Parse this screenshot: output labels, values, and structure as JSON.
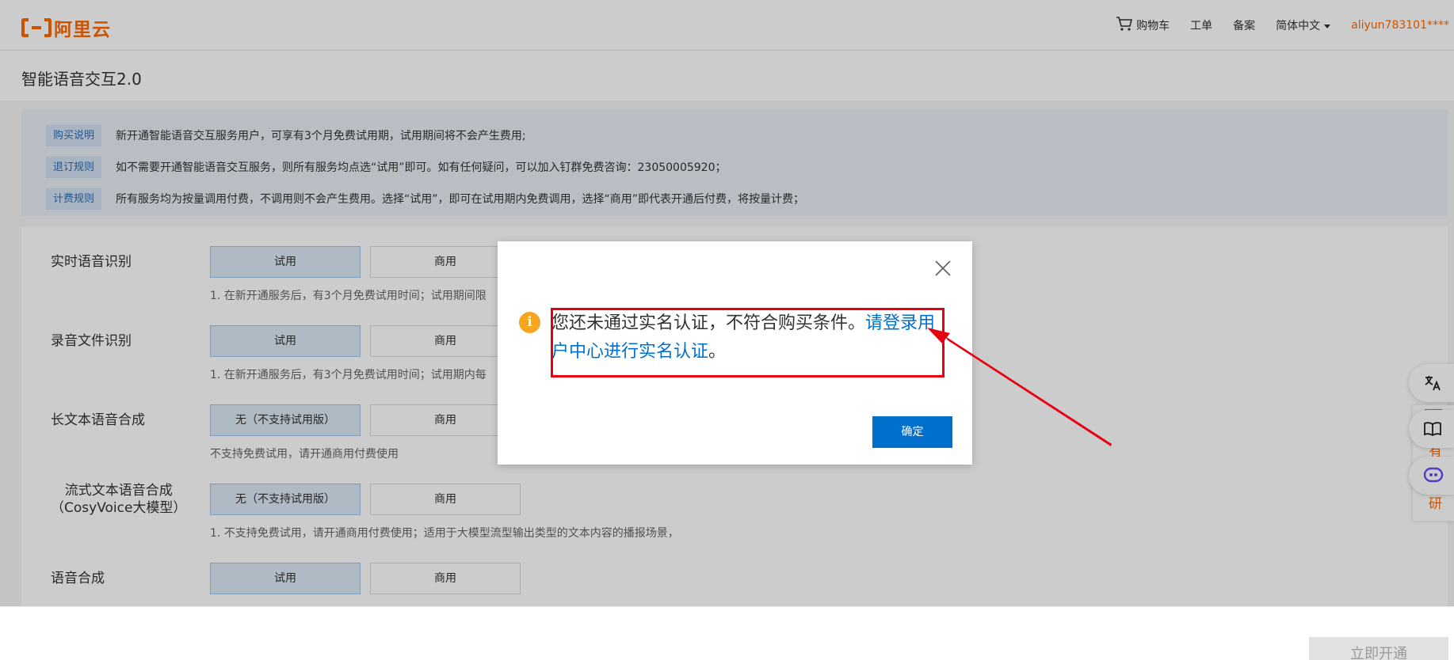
{
  "header": {
    "brand": "阿里云",
    "cart_label": "购物车",
    "ticket_label": "工单",
    "filing_label": "备案",
    "language_label": "简体中文",
    "user": "aliyun783101****"
  },
  "page": {
    "title": "智能语音交互2.0"
  },
  "notice": [
    {
      "tag": "购买说明",
      "text": "新开通智能语音交互服务用户，可享有3个月免费试用期，试用期间将不会产生费用;"
    },
    {
      "tag": "退订规则",
      "text": "如不需要开通智能语音交互服务，则所有服务均点选“试用”即可。如有任何疑问，可以加入钉群免费咨询：23050005920；"
    },
    {
      "tag": "计费规则",
      "text": "所有服务均为按量调用付费，不调用则不会产生费用。选择“试用”，即可在试用期内免费调用，选择“商用”即代表开通后付费，将按量计费；"
    }
  ],
  "services": [
    {
      "label": "实时语音识别",
      "trial": "试用",
      "commercial": "商用",
      "note": "1. 在新开通服务后，有3个月免费试用时间；试用期间限"
    },
    {
      "label": "录音文件识别",
      "trial": "试用",
      "commercial": "商用",
      "note": "1. 在新开通服务后，有3个月免费试用时间；试用期内每"
    },
    {
      "label": "长文本语音合成",
      "trial": "无（不支持试用版）",
      "commercial": "商用",
      "note": "不支持免费试用，请开通商用付费使用"
    },
    {
      "label_line1": "流式文本语音合成",
      "label_line2": "（CosyVoice大模型）",
      "trial": "无（不支持试用版）",
      "commercial": "商用",
      "note": "1. 不支持免费试用，请开通商用付费使用；适用于大模型流型输出类型的文本内容的播报场景，"
    },
    {
      "label": "语音合成",
      "trial": "试用",
      "commercial": "商用"
    }
  ],
  "footer": {
    "submit_label": "立即开通"
  },
  "side": {
    "char1": "有",
    "char2": "研"
  },
  "modal": {
    "message_prefix": "您还未通过实名认证，不符合购买条件。",
    "link_text": "请登录用户中心进行实名认证",
    "message_suffix": "。",
    "confirm_label": "确定",
    "icon_glyph": "i"
  },
  "colors": {
    "brand": "#ff6a00",
    "link": "#0070cc",
    "annotation": "#e60012",
    "warning": "#f5a623"
  }
}
